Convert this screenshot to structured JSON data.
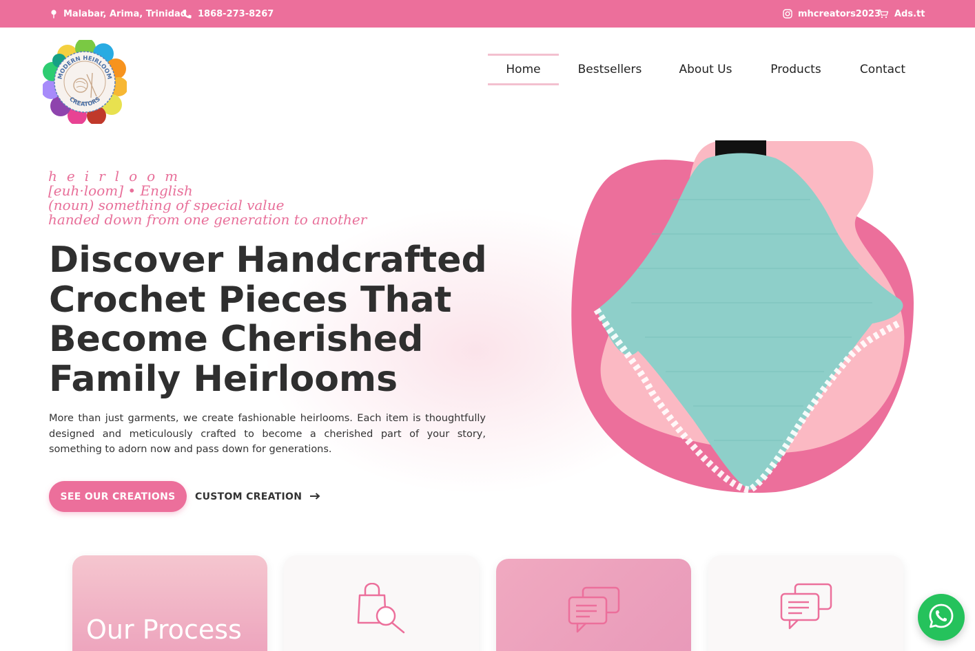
{
  "topbar": {
    "location": "Malabar, Arima, Trinidad",
    "phone": "1868-273-8267",
    "instagram": "mhcreators2023",
    "shop": "Ads.tt",
    "background": "#ec6f9b"
  },
  "logo": {
    "ring_text_top": "MODERN HEIRLOOM",
    "ring_text_bottom": "CREATORS"
  },
  "nav": {
    "items": [
      {
        "label": "Home",
        "active": true
      },
      {
        "label": "Bestsellers"
      },
      {
        "label": "About Us"
      },
      {
        "label": "Products"
      },
      {
        "label": "Contact"
      }
    ]
  },
  "hero": {
    "definition": {
      "word": "heirloom",
      "pronunciation": "[euh·loom] • English",
      "noun": "(noun) something of special value",
      "meaning": "handed down from one generation to another"
    },
    "headline_lines": [
      "Discover Handcrafted",
      "Crochet Pieces That",
      "Become Cherished",
      "Family Heirlooms"
    ],
    "lead": "More than just garments, we create fashionable heirlooms. Each item is thoughtfully designed and meticulously crafted to become a cherished part of your story, something to adorn now and pass down for generations.",
    "primary_button": "SEE OUR CREATIONS",
    "secondary_button": "CUSTOM CREATION"
  },
  "process": {
    "title": "Our Process"
  },
  "colors": {
    "accent": "#ec6f9b",
    "blob_dark": "#ec6f9b",
    "blob_light": "#fbb9c3",
    "shawl": "#8ecfc9",
    "whatsapp": "#25c25c"
  },
  "icons": {
    "location": "map-pin-icon",
    "phone": "phone-icon",
    "instagram": "instagram-icon",
    "cart": "cart-icon",
    "arrow": "arrow-right-icon",
    "bag_search": "shopping-bag-search-icon",
    "chat": "chat-bubbles-icon",
    "whatsapp": "whatsapp-icon"
  }
}
